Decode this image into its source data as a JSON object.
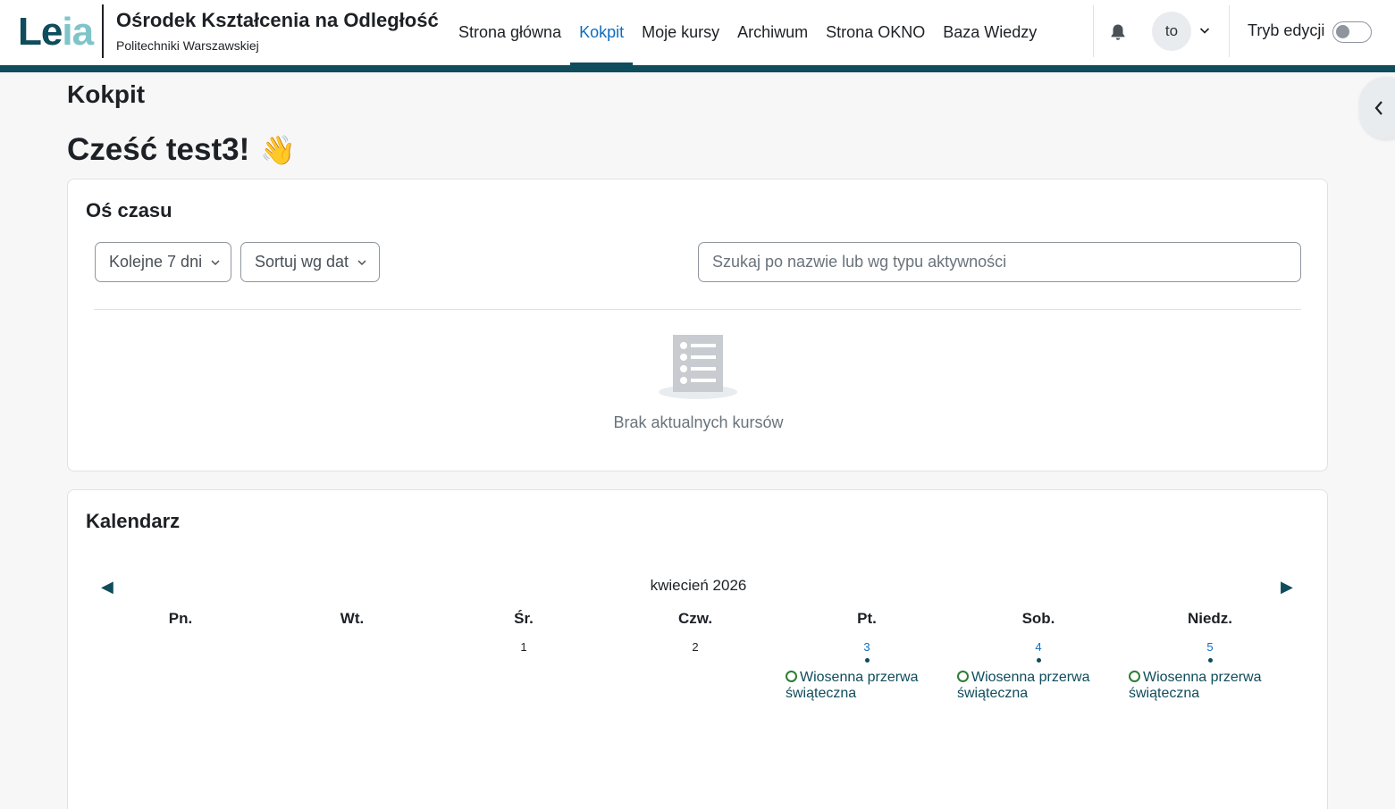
{
  "brand": {
    "logo_le": "Le",
    "logo_ia": "ia",
    "title": "Ośrodek Kształcenia na Odległość",
    "subtitle": "Politechniki Warszawskiej"
  },
  "nav": {
    "items": [
      {
        "label": "Strona główna"
      },
      {
        "label": "Kokpit"
      },
      {
        "label": "Moje kursy"
      },
      {
        "label": "Archiwum"
      },
      {
        "label": "Strona OKNO"
      },
      {
        "label": "Baza Wiedzy"
      }
    ],
    "active": "Kokpit"
  },
  "user": {
    "avatar_initials": "to",
    "edit_mode_label": "Tryb edycji",
    "edit_mode_on": false
  },
  "page": {
    "title": "Kokpit",
    "greeting": "Cześć test3!",
    "greeting_emoji": "👋"
  },
  "timeline": {
    "title": "Oś czasu",
    "range_label": "Kolejne 7 dni",
    "sort_label": "Sortuj wg dat",
    "search_placeholder": "Szukaj po nazwie lub wg typu aktywności",
    "empty_text": "Brak aktualnych kursów"
  },
  "calendar": {
    "title": "Kalendarz",
    "month": "kwiecień 2026",
    "prev_icon": "◀",
    "next_icon": "▶",
    "weekdays": [
      "Pn.",
      "Wt.",
      "Śr.",
      "Czw.",
      "Pt.",
      "Sob.",
      "Niedz."
    ],
    "week": [
      {
        "day": "",
        "event": ""
      },
      {
        "day": "",
        "event": ""
      },
      {
        "day": "1",
        "event": ""
      },
      {
        "day": "2",
        "event": ""
      },
      {
        "day": "3",
        "event": "Wiosenna przerwa świąteczna"
      },
      {
        "day": "4",
        "event": "Wiosenna przerwa świąteczna"
      },
      {
        "day": "5",
        "event": "Wiosenna przerwa świąteczna"
      }
    ]
  },
  "colors": {
    "brand_dark": "#0f4c5c",
    "link": "#0f6cbf",
    "event_circle": "#2e7d32"
  }
}
